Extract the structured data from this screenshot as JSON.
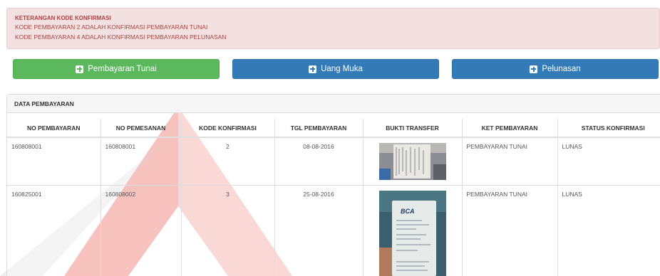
{
  "alert": {
    "title": "KETERANGAN KODE KONFIRMASI",
    "line1": "KODE PEMBAYARAN 2 ADALAH KONFIRMASI PEMBAYARAN TUNAI",
    "line2": "KODE PEMBAYARAN 4 ADALAH KONFIRMASI PEMBAYARAN PELUNASAN"
  },
  "buttons": {
    "tunai": "Pembayaran Tunai",
    "uang_muka": "Uang Muka",
    "pelunasan": "Pelunasan"
  },
  "panel": {
    "title": "DATA PEMBAYARAN"
  },
  "table": {
    "headers": [
      "NO PEMBAYARAN",
      "NO PEMESANAN",
      "KODE KONFIRMASI",
      "TGL PEMBAYARAN",
      "BUKTI TRANSFER",
      "KET PEMBAYARAN",
      "STATUS KONFIRMASI"
    ],
    "rows": [
      {
        "no_pembayaran": "160808001",
        "no_pemesanan": "160808001",
        "kode": "2",
        "tgl": "08-08-2016",
        "ket": "PEMBAYARAN TUNAI",
        "status": "LUNAS"
      },
      {
        "no_pembayaran": "160825001",
        "no_pemesanan": "160808002",
        "kode": "3",
        "tgl": "25-08-2016",
        "ket": "PEMBAYARAN TUNAI",
        "status": "LUNAS"
      }
    ],
    "receipt2_brand": "BCA"
  },
  "colors": {
    "green": "#5cb85c",
    "blue": "#337ab7",
    "alert_text": "#a94442",
    "alert_bg": "#f2dede"
  }
}
